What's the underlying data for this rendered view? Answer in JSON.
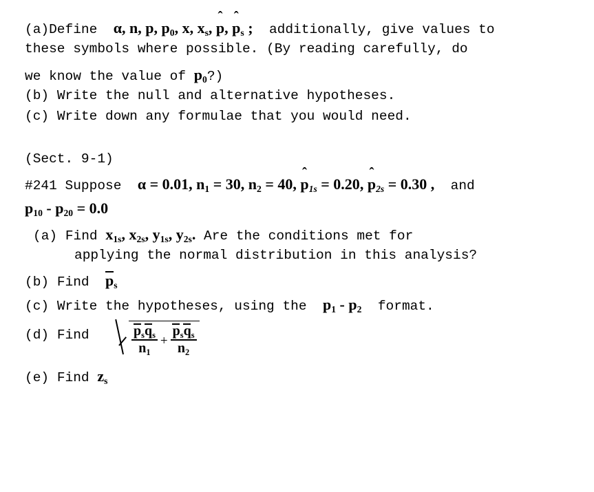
{
  "document": {
    "background_color": "#ffffff",
    "text_color": "#000000",
    "part_a": {
      "label": "(a)",
      "lead": "Define",
      "symbols": [
        {
          "base": "α",
          "sep": ","
        },
        {
          "base": "n",
          "sep": ","
        },
        {
          "base": "p",
          "sep": ","
        },
        {
          "base": "p",
          "sub": "0",
          "sep": ","
        },
        {
          "base": "x",
          "sep": ","
        },
        {
          "base": "x",
          "sub": "s",
          "sep": ","
        },
        {
          "base": "p",
          "hat": true,
          "sep": ","
        },
        {
          "base": "p",
          "hat": true,
          "sub": "s",
          "sep": ";"
        }
      ],
      "line1_tail": "additionally, give values to",
      "line2": "these symbols where possible. (By reading carefully, do",
      "line3_pre": "we know the value of",
      "line3_symbol_base": "p",
      "line3_symbol_sub": "0",
      "line3_tail": "?)"
    },
    "part_b": {
      "label": "(b)",
      "text": "Write the null and alternative hypotheses."
    },
    "part_c": {
      "label": "(c)",
      "text": "Write down any formulae that you would need."
    },
    "section_ref": "(Sect. 9-1)",
    "problem": {
      "number": "#241",
      "lead": "Suppose",
      "givens": [
        {
          "symbol": "α",
          "relation": "=",
          "value": "0.01",
          "sep": ","
        },
        {
          "symbol": "n",
          "sub": "1",
          "relation": "=",
          "value": "30",
          "sep": ","
        },
        {
          "symbol": "n",
          "sub": "2",
          "relation": "=",
          "value": "40",
          "sep": ","
        },
        {
          "symbol": "p",
          "hat": true,
          "sub": "1s",
          "relation": "=",
          "value": "0.20",
          "sep": ","
        },
        {
          "symbol": "p",
          "hat": true,
          "sub": "2s",
          "relation": "=",
          "value": "0.30",
          "sep": ","
        }
      ],
      "trailing_word": "and",
      "line2": {
        "term1_base": "p",
        "term1_sub": "10",
        "operator": "-",
        "term2_base": "p",
        "term2_sub": "20",
        "relation": "=",
        "value": "0.0"
      },
      "items": {
        "a": {
          "label": "(a)",
          "lead": "Find",
          "variables": [
            {
              "base": "x",
              "sub": "1s",
              "sep": ","
            },
            {
              "base": "x",
              "sub": "2s",
              "sep": ","
            },
            {
              "base": "y",
              "sub": "1s",
              "sep": ","
            },
            {
              "base": "y",
              "sub": "2s",
              "sep": "."
            }
          ],
          "tail": "Are the conditions met for",
          "line2": "applying the normal distribution in this analysis?"
        },
        "b": {
          "label": "(b)",
          "lead": "Find",
          "variable_base": "p",
          "variable_bar": true,
          "variable_sub": "s"
        },
        "c": {
          "label": "(c)",
          "lead": "Write the hypotheses, using the",
          "format_term1_base": "p",
          "format_term1_sub": "1",
          "format_operator": "-",
          "format_term2_base": "p",
          "format_term2_sub": "2",
          "tail": "format."
        },
        "d": {
          "label": "(d)",
          "lead": "Find",
          "formula": {
            "type": "sqrt",
            "fraction1": {
              "numerator": [
                {
                  "base": "p",
                  "bar": true,
                  "sub": "s"
                },
                {
                  "base": "q",
                  "bar": true,
                  "sub": "s"
                }
              ],
              "denominator_base": "n",
              "denominator_sub": "1"
            },
            "operator": "+",
            "fraction2": {
              "numerator": [
                {
                  "base": "p",
                  "bar": true,
                  "sub": "s"
                },
                {
                  "base": "q",
                  "bar": true,
                  "sub": "s"
                }
              ],
              "denominator_base": "n",
              "denominator_sub": "2"
            }
          }
        },
        "e": {
          "label": "(e)",
          "lead": "Find",
          "variable_base": "z",
          "variable_sub": "s"
        }
      }
    }
  }
}
